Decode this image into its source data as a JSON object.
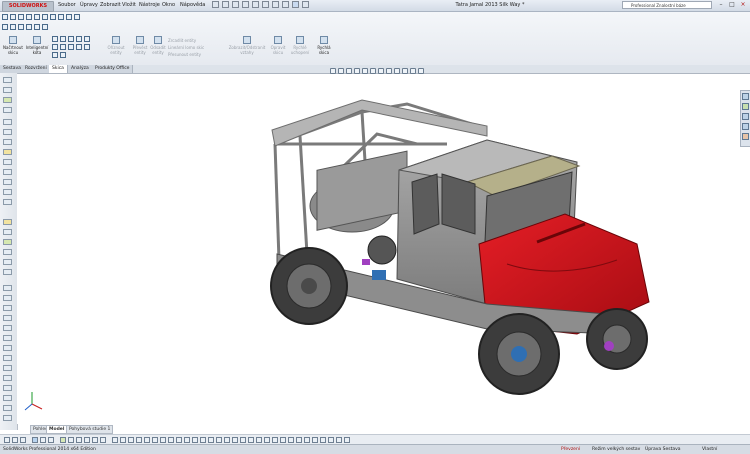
{
  "titlebar": {
    "logo": "SOLIDWORKS",
    "menus": [
      "Soubor",
      "Úpravy",
      "Zobrazit",
      "Vložit",
      "Nástroje",
      "Okno",
      "Nápověda"
    ],
    "document_title": "Tatra Jamal 2013 Silk Way *",
    "search_placeholder": "Professional Znalostní báze",
    "minimize": "–",
    "maximize": "□",
    "close": "×"
  },
  "command_manager": {
    "sketch_button": "Načrtnout skicu",
    "smart_dimension": "Inteligentní kóta",
    "trim": "Oříznout entity",
    "offset": "Převést entity",
    "offset_entities": "Odsadit entity",
    "mirror": "Zrcadlit entity",
    "linear_pattern": "Lineární lomo skic",
    "move_entities": "Přesunout entity",
    "display_relations": "Zobrazit/Odstranit vztahy",
    "repair_sketch": "Opravit skicu",
    "quick_snaps": "Rychlé uchopení",
    "rapid_sketch": "Rychlá skica"
  },
  "tabs": [
    "Sestava",
    "Rozvržení",
    "Skica",
    "Analýza",
    "Produkty Office"
  ],
  "active_tab": "Skica",
  "bottom_tabs": [
    "Pohled 3D",
    "Model",
    "Pohybová studie 1"
  ],
  "active_bottom_tab": "Model",
  "statusbar": {
    "app": "SolidWorks Professional 2014 x64 Edition",
    "warning": "Převzení",
    "mode": "Režim velkých sestav",
    "editing": "Úprava Sestava",
    "units": "Vlastní"
  },
  "colors": {
    "cab_red": "#d0101a",
    "chassis_gray": "#8d8d8d",
    "cab_roof": "#b5b08a",
    "accent_blue": "#2f6fb3"
  }
}
